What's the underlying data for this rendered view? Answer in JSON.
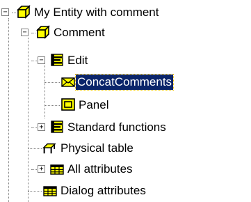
{
  "tree": {
    "expanded_glyph": "−",
    "collapsed_glyph": "+",
    "nodes": [
      {
        "label": "My Entity with comment",
        "icon": "entity-cube-icon",
        "expander": "expanded"
      },
      {
        "label": "Comment",
        "icon": "entity-cube-icon",
        "expander": "expanded"
      },
      {
        "label": "Edit",
        "icon": "function-group-icon",
        "expander": "expanded"
      },
      {
        "label": "ConcatComments",
        "icon": "envelope-icon",
        "expander": "none",
        "selected": true
      },
      {
        "label": "Panel",
        "icon": "panel-icon",
        "expander": "none"
      },
      {
        "label": "Standard functions",
        "icon": "function-group-icon",
        "expander": "collapsed"
      },
      {
        "label": "Physical table",
        "icon": "physical-table-icon",
        "expander": "none"
      },
      {
        "label": "All attributes",
        "icon": "attribute-grid-icon",
        "expander": "collapsed"
      },
      {
        "label": "Dialog attributes",
        "icon": "attribute-grid-icon",
        "expander": "none"
      }
    ]
  },
  "colors": {
    "selection_bg": "#0a246a",
    "selection_text": "#ffffff",
    "icon_yellow": "#ffff00",
    "icon_outline": "#000000",
    "tree_line": "#808080"
  }
}
